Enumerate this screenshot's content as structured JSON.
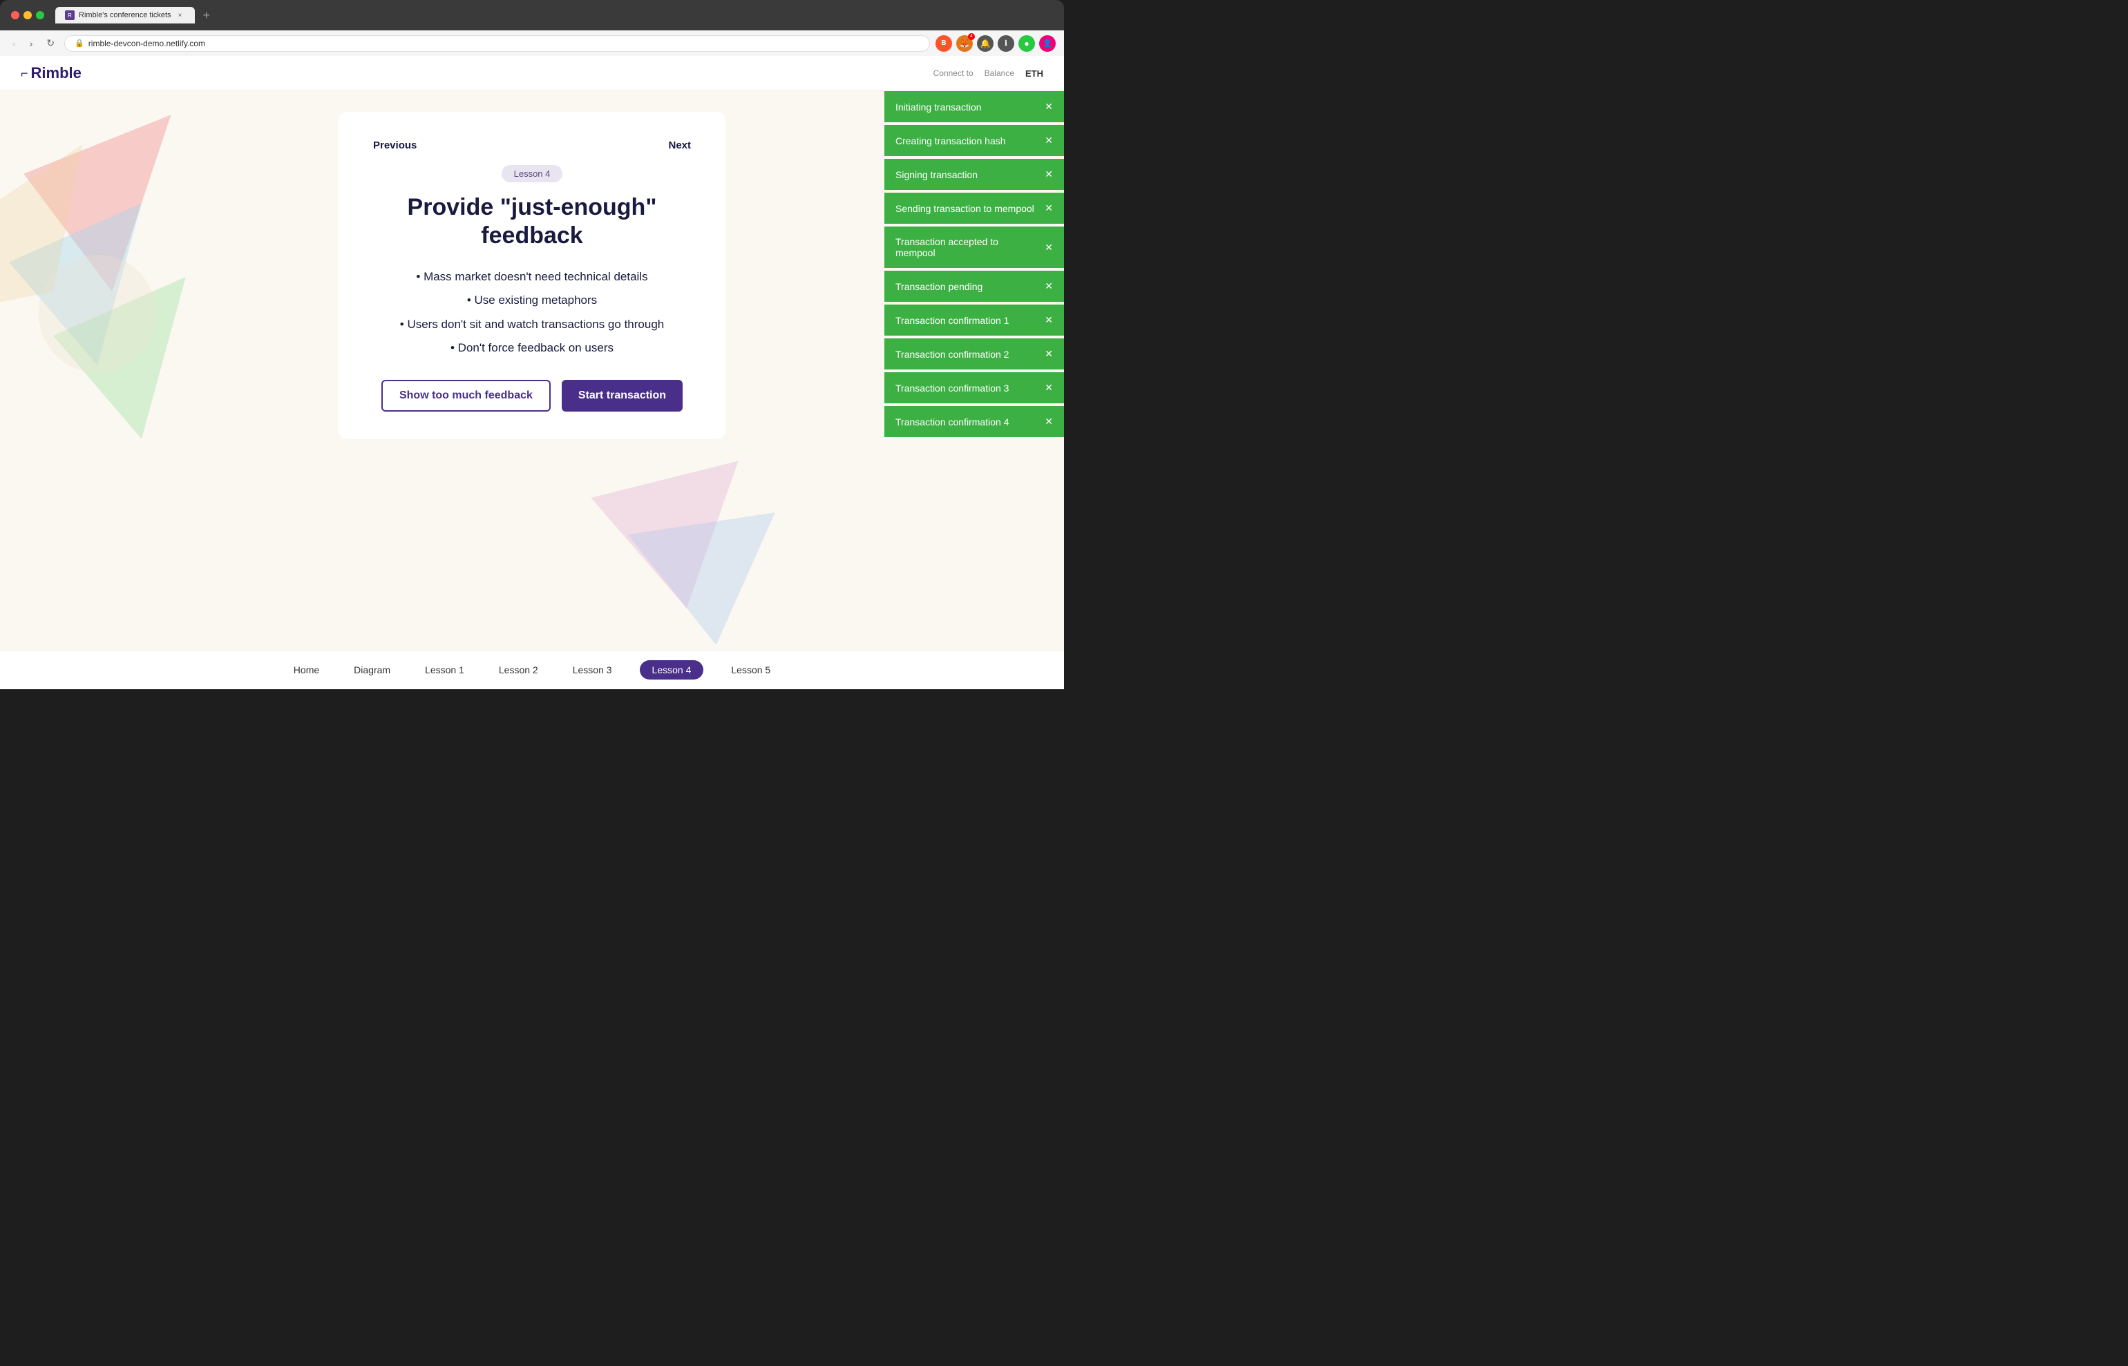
{
  "browser": {
    "tab_label": "Rimble's conference tickets",
    "tab_close": "×",
    "new_tab": "+",
    "nav": {
      "back": "‹",
      "forward": "›",
      "reload": "↻",
      "bookmark": "⊕",
      "address": "rimble-devcon-demo.netlify.com"
    },
    "extensions": {
      "brave_label": "B",
      "meta_label": "🦊",
      "meta_badge": "4",
      "bell_label": "🔔",
      "info_label": "ℹ",
      "record_label": "●",
      "avatar_label": "👤"
    }
  },
  "app": {
    "logo": "Rimble",
    "logo_prefix": "⌐",
    "eth_balance": "ETH",
    "connect_label": "Connect to",
    "balance_label": "Balance"
  },
  "lesson": {
    "badge": "Lesson 4",
    "title": "Provide \"just-enough\" feedback",
    "bullets": [
      "• Mass market doesn't need technical details",
      "• Use existing metaphors",
      "• Users don't sit and watch transactions go through",
      "• Don't force feedback on users"
    ],
    "prev_label": "Previous",
    "next_label": "Next",
    "btn_too_much": "Show too much feedback",
    "btn_start": "Start transaction"
  },
  "nav_links": [
    {
      "label": "Home",
      "active": false
    },
    {
      "label": "Diagram",
      "active": false
    },
    {
      "label": "Lesson 1",
      "active": false
    },
    {
      "label": "Lesson 2",
      "active": false
    },
    {
      "label": "Lesson 3",
      "active": false
    },
    {
      "label": "Lesson 4",
      "active": true
    },
    {
      "label": "Lesson 5",
      "active": false
    }
  ],
  "toasts": [
    {
      "id": 0,
      "label": "Initiating transaction"
    },
    {
      "id": 1,
      "label": "Creating transaction hash"
    },
    {
      "id": 2,
      "label": "Signing transaction"
    },
    {
      "id": 3,
      "label": "Sending transaction to mempool"
    },
    {
      "id": 4,
      "label": "Transaction accepted to mempool"
    },
    {
      "id": 5,
      "label": "Transaction pending"
    },
    {
      "id": 6,
      "label": "Transaction confirmation 1"
    },
    {
      "id": 7,
      "label": "Transaction confirmation 2"
    },
    {
      "id": 8,
      "label": "Transaction confirmation 3"
    },
    {
      "id": 9,
      "label": "Transaction confirmation 4"
    }
  ],
  "colors": {
    "toast_bg": "#3cb043",
    "primary": "#4a2f8a",
    "logo": "#2d1b6e",
    "page_bg": "#faf8f0"
  }
}
